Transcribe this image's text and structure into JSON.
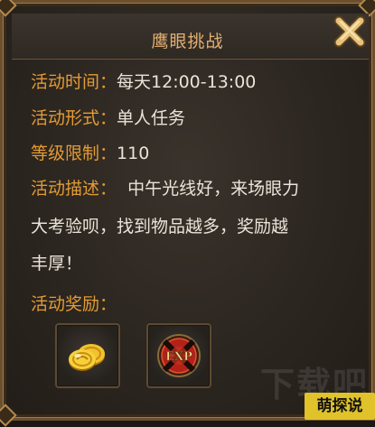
{
  "dialog": {
    "title": "鹰眼挑战"
  },
  "info": {
    "time_label": "活动时间：",
    "time_value": "每天12:00-13:00",
    "form_label": "活动形式：",
    "form_value": "单人任务",
    "level_label": "等级限制：",
    "level_value": "110",
    "desc_label": "活动描述：",
    "desc_line1": "中午光线好，来场眼力",
    "desc_line2": "大考验呗，找到物品越多，奖励越",
    "desc_line3": "丰厚！"
  },
  "rewards": {
    "label": "活动奖励：",
    "items": [
      {
        "icon": "gold-coins-icon"
      },
      {
        "icon": "exp-orb-icon",
        "text": "EXP"
      }
    ]
  },
  "watermark": {
    "text": "下载吧"
  },
  "corner_badge": {
    "text": "萌探说"
  },
  "colors": {
    "label": "#e39b34",
    "value": "#eae3d8",
    "title": "#e4b072",
    "border": "#a27b45"
  }
}
